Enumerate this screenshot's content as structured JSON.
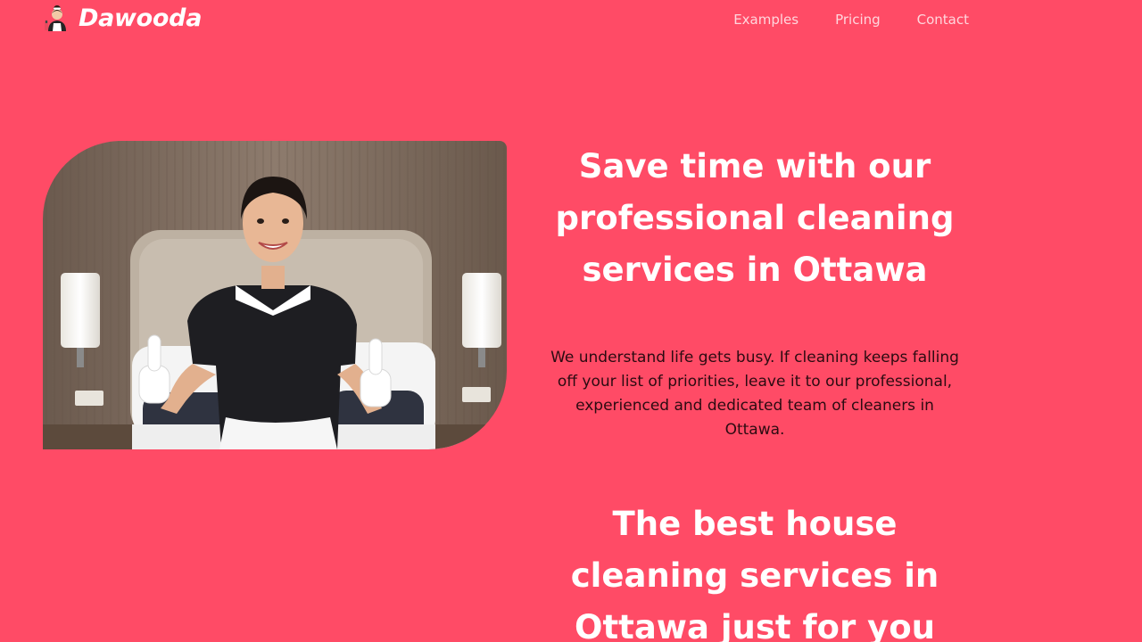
{
  "header": {
    "logo_text": "Dawooda",
    "nav": [
      {
        "label": "Examples"
      },
      {
        "label": "Pricing"
      },
      {
        "label": "Contact"
      }
    ]
  },
  "hero": {
    "heading": "Save time with our professional cleaning services in Ottawa",
    "paragraph": "We understand life gets busy. If cleaning keeps falling off your list of priorities, leave it to our professional, experienced and dedicated team of cleaners in Ottawa."
  },
  "section": {
    "heading": "The best house cleaning services in Ottawa just for you"
  },
  "icons": {
    "logo": "maid-icon"
  },
  "colors": {
    "background": "#ff4b66",
    "heading": "#ffffff",
    "body_text": "#2b0b11",
    "nav_link": "#ffd6dd"
  }
}
